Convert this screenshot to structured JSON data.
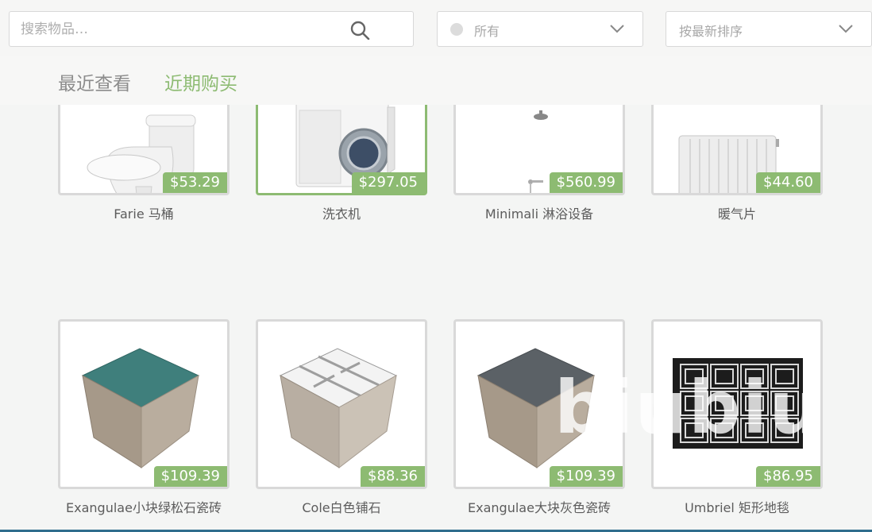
{
  "search": {
    "placeholder": "搜索物品…",
    "icon": "search-icon"
  },
  "filter_dropdown": {
    "selected": "所有",
    "icon": "chevron-down-icon"
  },
  "sort_dropdown": {
    "selected": "按最新排序",
    "icon": "chevron-down-icon"
  },
  "tabs": [
    {
      "label": "最近查看",
      "active": false
    },
    {
      "label": "近期购买",
      "active": true
    }
  ],
  "colors": {
    "accent": "#8dbb72",
    "card_border": "#d9d9d9",
    "bottom_bar": "#2f6d8d"
  },
  "items": [
    {
      "name": "Farie 马桶",
      "price": "$53.29",
      "icon": "toilet-image"
    },
    {
      "name": "洗衣机",
      "price": "$297.05",
      "icon": "washing-machine-image",
      "selected": true
    },
    {
      "name": "Minimali 淋浴设备",
      "price": "$560.99",
      "icon": "shower-image"
    },
    {
      "name": "暖气片",
      "price": "$44.60",
      "icon": "radiator-image"
    },
    {
      "name": "Exangulae小块绿松石瓷砖",
      "price": "$109.39",
      "icon": "turquoise-tile-image"
    },
    {
      "name": "Cole白色铺石",
      "price": "$88.36",
      "icon": "white-paver-image"
    },
    {
      "name": "Exangulae大块灰色瓷砖",
      "price": "$109.39",
      "icon": "gray-tile-image"
    },
    {
      "name": "Umbriel 矩形地毯",
      "price": "$86.95",
      "icon": "rug-image"
    }
  ],
  "watermark": "biubiu"
}
